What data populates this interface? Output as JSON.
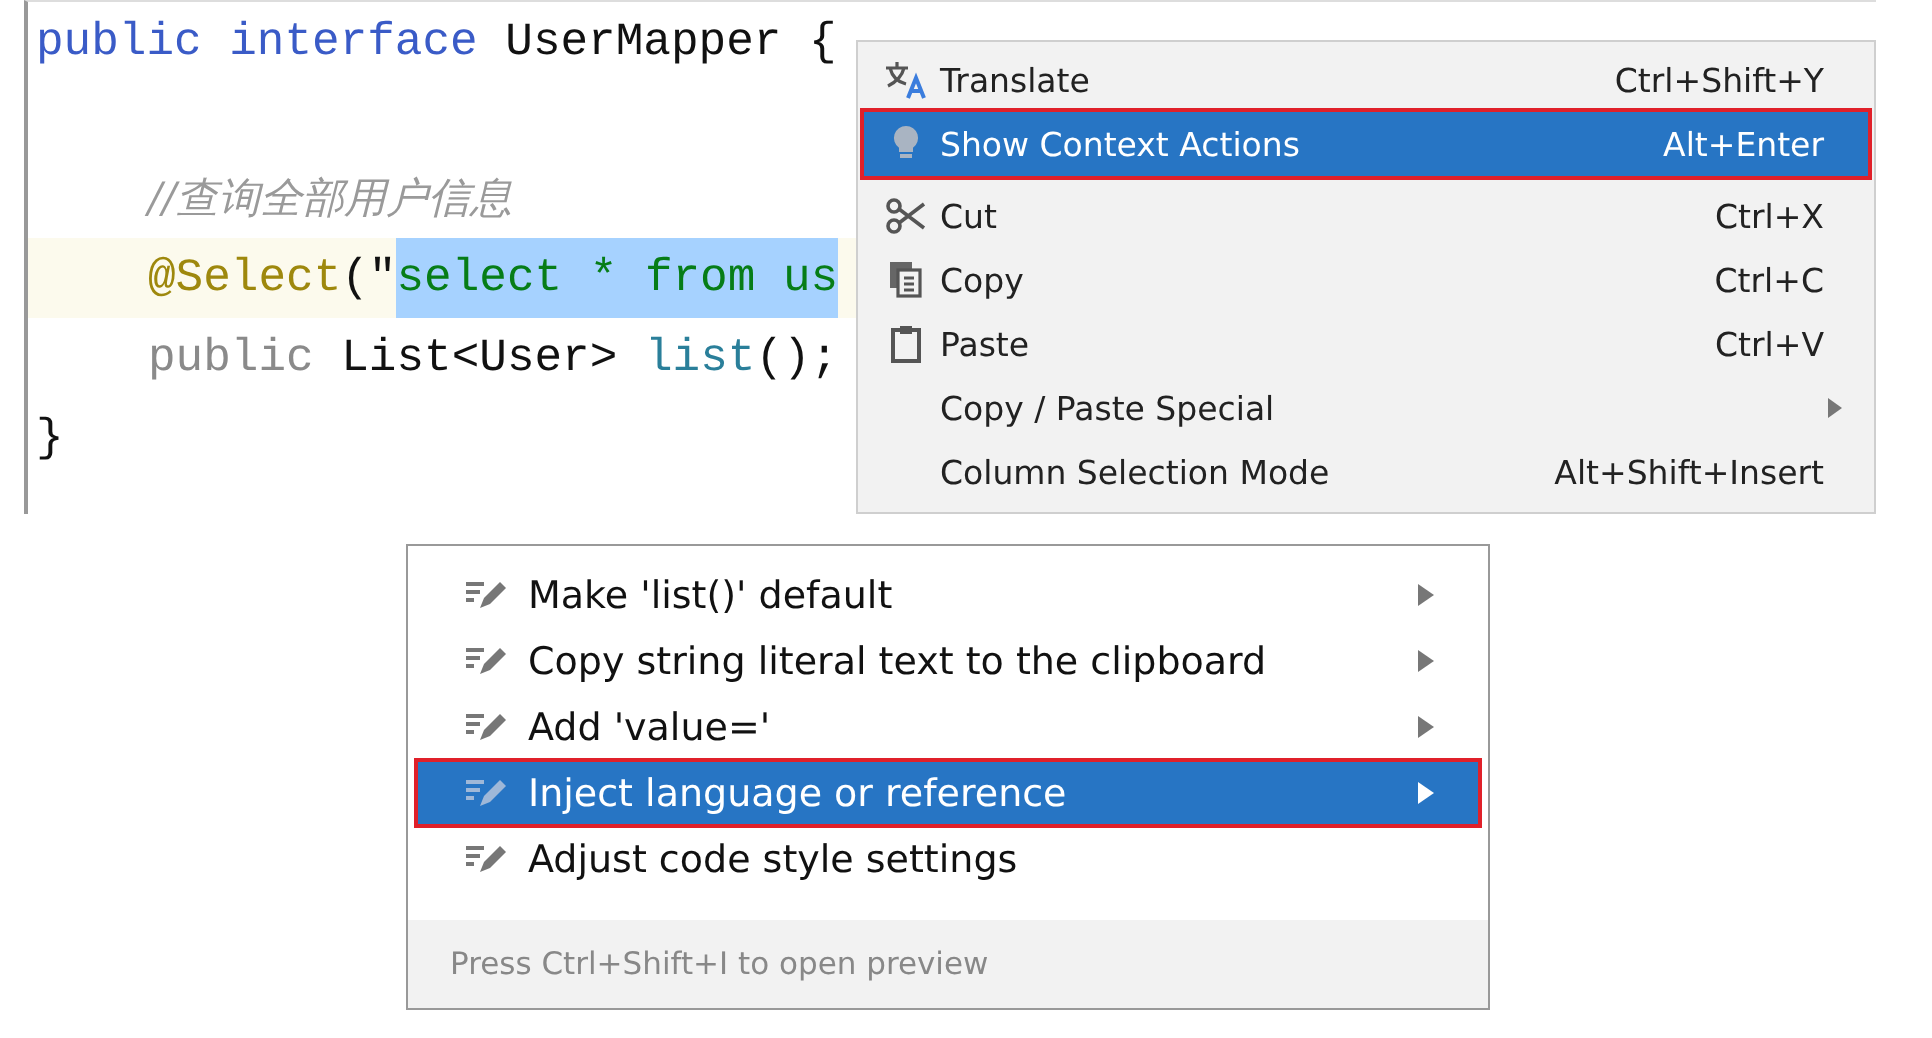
{
  "editor": {
    "lines": [
      {
        "highlighted": false,
        "tokens": [
          {
            "kind": "keyword",
            "text": "public interface"
          },
          {
            "kind": "plain",
            "text": " UserMapper "
          },
          {
            "kind": "plain",
            "text": "{"
          }
        ]
      },
      {
        "highlighted": false
      },
      {
        "highlighted": false,
        "tokens": [
          {
            "kind": "comment",
            "text": "//查询全部用户信息"
          }
        ]
      },
      {
        "highlighted": true,
        "tokens": [
          {
            "kind": "annotation",
            "text": "@Select"
          },
          {
            "kind": "plain",
            "text": "(\""
          },
          {
            "kind": "selected-string",
            "text": "select * from us"
          }
        ]
      },
      {
        "highlighted": false,
        "tokens": [
          {
            "kind": "unused",
            "text": "public"
          },
          {
            "kind": "plain",
            "text": " List<User> "
          },
          {
            "kind": "method",
            "text": "list"
          },
          {
            "kind": "plain",
            "text": "();"
          }
        ]
      },
      {
        "highlighted": false,
        "tokens": [
          {
            "kind": "plain",
            "text": "}"
          }
        ]
      }
    ]
  },
  "context_menu": {
    "items": [
      {
        "kind": "translate",
        "label": "Translate",
        "shortcut": "Ctrl+Shift+Y",
        "submenu": false,
        "selected": false,
        "outlined": false
      },
      {
        "kind": "bulb",
        "label": "Show Context Actions",
        "shortcut": "Alt+Enter",
        "submenu": false,
        "selected": true,
        "outlined": true
      },
      {
        "kind": "scissors",
        "label": "Cut",
        "shortcut": "Ctrl+X",
        "submenu": false,
        "selected": false,
        "outlined": false
      },
      {
        "kind": "copy",
        "label": "Copy",
        "shortcut": "Ctrl+C",
        "submenu": false,
        "selected": false,
        "outlined": false
      },
      {
        "kind": "clipboard",
        "label": "Paste",
        "shortcut": "Ctrl+V",
        "submenu": false,
        "selected": false,
        "outlined": false
      },
      {
        "kind": "plain",
        "label": "Copy / Paste Special",
        "submenu": true,
        "selected": false,
        "outlined": false
      },
      {
        "kind": "plain",
        "label": "Column Selection Mode",
        "shortcut": "Alt+Shift+Insert",
        "submenu": false,
        "selected": false,
        "outlined": false
      }
    ]
  },
  "intentions_popup": {
    "items": [
      {
        "label": "Make 'list()' default",
        "submenu": true,
        "selected": false,
        "outlined": false
      },
      {
        "label": "Copy string literal text to the clipboard",
        "submenu": true,
        "selected": false,
        "outlined": false
      },
      {
        "label": "Add 'value='",
        "submenu": true,
        "selected": false,
        "outlined": false
      },
      {
        "label": "Inject language or reference",
        "submenu": true,
        "selected": true,
        "outlined": true
      },
      {
        "label": "Adjust code style settings",
        "submenu": false,
        "selected": false,
        "outlined": false
      }
    ],
    "footer": "Press Ctrl+Shift+I to open preview"
  }
}
